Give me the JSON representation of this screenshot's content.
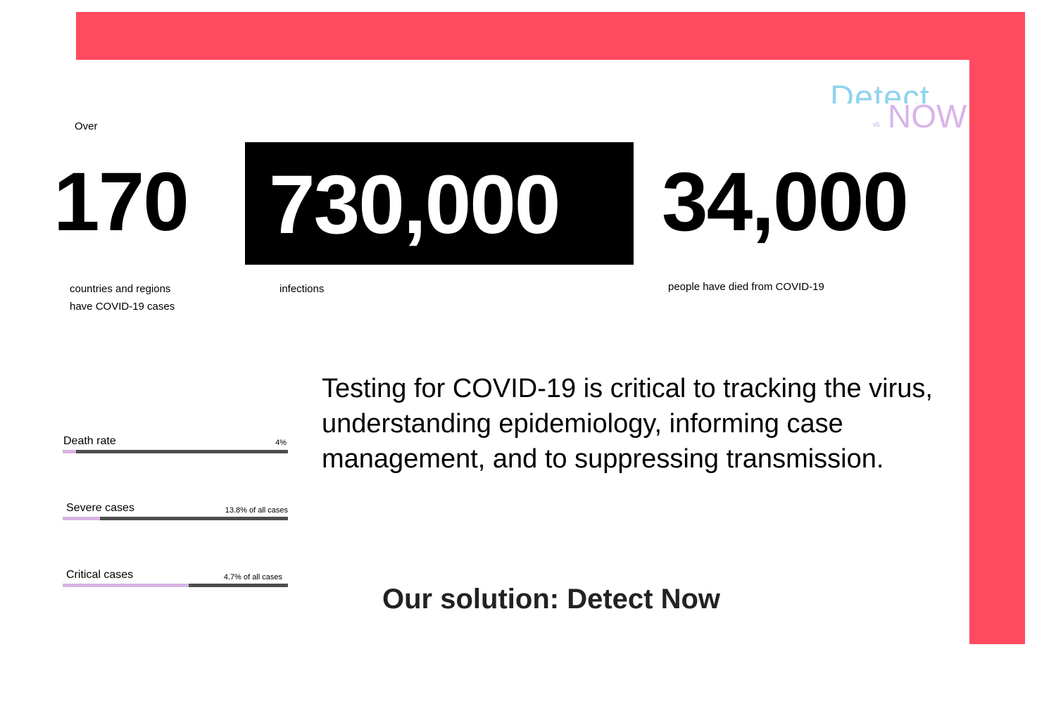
{
  "brand": {
    "accent": "#ff4a60",
    "logo_top": "Detect",
    "logo_bottom": "NOW",
    "logo_mark": "v5"
  },
  "headline_stats": {
    "countries": {
      "prefix": "Over",
      "value": "170",
      "caption": "countries and regions have COVID-19 cases"
    },
    "infections": {
      "value": "730,000",
      "caption": "infections"
    },
    "deaths": {
      "value": "34,000",
      "caption": "people have died from COVID-19"
    }
  },
  "rates": [
    {
      "label": "Death rate",
      "value_text": "4%",
      "fill_fraction": 0.06
    },
    {
      "label": "Severe cases",
      "value_text": "13.8% of all cases",
      "fill_fraction": 0.165
    },
    {
      "label": "Critical cases",
      "value_text": "4.7% of all cases",
      "fill_fraction": 0.56
    }
  ],
  "quote": "Testing for COVID-19 is critical to tracking the virus, understanding epidemiology, informing case management, and to suppressing transmission.",
  "solution": "Our solution: Detect Now"
}
